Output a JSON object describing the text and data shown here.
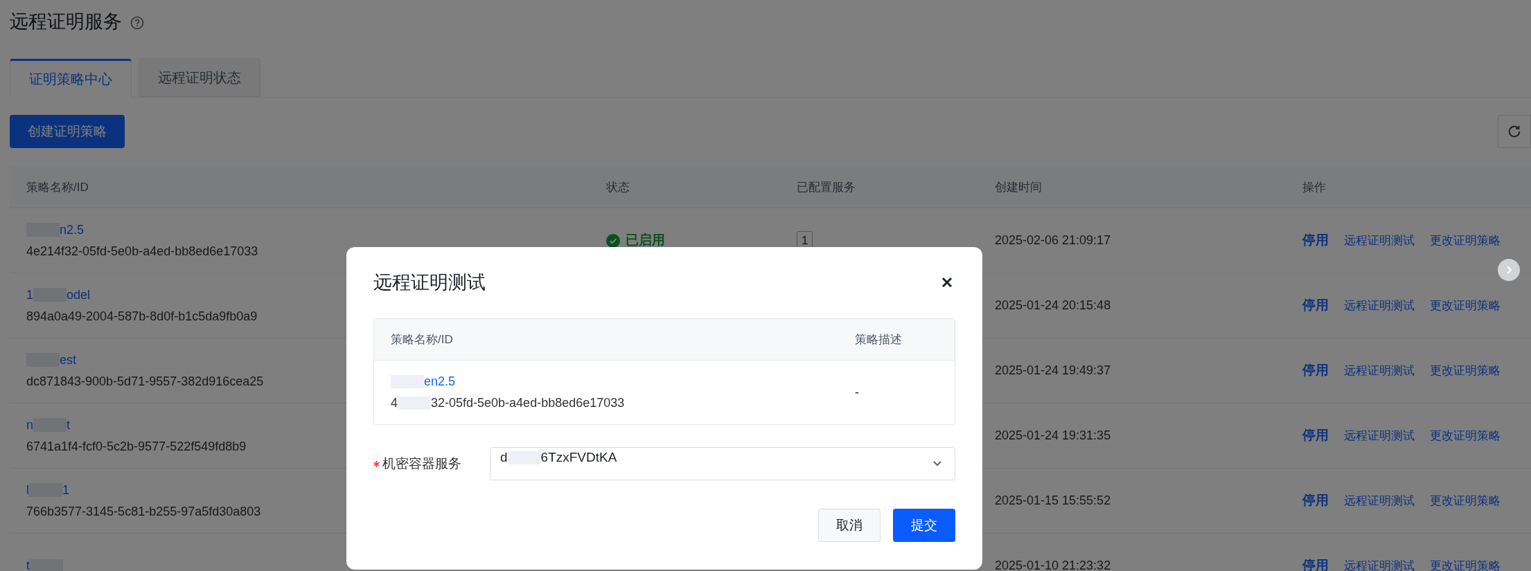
{
  "page": {
    "title": "远程证明服务"
  },
  "tabs": [
    {
      "label": "证明策略中心",
      "selected": true
    },
    {
      "label": "远程证明状态",
      "selected": false
    }
  ],
  "create_button": "创建证明策略",
  "table": {
    "columns": [
      "策略名称/ID",
      "状态",
      "已配置服务",
      "创建时间",
      "操作"
    ],
    "rows": [
      {
        "name": {
          "parts": [
            "n2.5"
          ],
          "mask_first": true,
          "mask_last": false
        },
        "id": "4e214f32-05fd-5e0b-a4ed-bb8ed6e17033",
        "status": {
          "text": "已启用",
          "enabled": true
        },
        "services": "1",
        "created": "2025-02-06 21:09:17",
        "actions": [
          "停用",
          "远程证明测试",
          "更改证明策略"
        ]
      },
      {
        "name": {
          "parts": [
            "1",
            "odel"
          ],
          "mask_first": false,
          "mask_last": false
        },
        "id": "894a0a49-2004-587b-8d0f-b1c5da9fb0a9",
        "created": "2025-01-24 20:15:48",
        "actions": [
          "停用",
          "远程证明测试",
          "更改证明策略"
        ]
      },
      {
        "name": {
          "parts": [
            "est"
          ],
          "mask_first": true,
          "mask_last": false
        },
        "id": "dc871843-900b-5d71-9557-382d916cea25",
        "created": "2025-01-24 19:49:37",
        "actions": [
          "停用",
          "远程证明测试",
          "更改证明策略"
        ]
      },
      {
        "name": {
          "parts": [
            "n",
            "t"
          ],
          "mask_first": false,
          "mask_last": false
        },
        "id": "6741a1f4-fcf0-5c2b-9577-522f549fd8b9",
        "created": "2025-01-24 19:31:35",
        "actions": [
          "停用",
          "远程证明测试",
          "更改证明策略"
        ]
      },
      {
        "name": {
          "parts": [
            "l",
            "1"
          ],
          "mask_first": false,
          "mask_last": false
        },
        "id": "766b3577-3145-5c81-b255-97a5fd30a803",
        "created": "2025-01-15 15:55:52",
        "actions": [
          "停用",
          "远程证明测试",
          "更改证明策略"
        ]
      },
      {
        "name": {
          "parts": [
            "t"
          ],
          "mask_first": false,
          "mask_last": true
        },
        "created": "2025-01-10 21:23:32",
        "actions": [
          "停用",
          "远程证明测试",
          "更改证明策略"
        ]
      }
    ]
  },
  "modal": {
    "title": "远程证明测试",
    "table": {
      "columns": [
        "策略名称/ID",
        "策略描述"
      ],
      "rows": [
        {
          "name": {
            "parts": [
              "en2.5"
            ],
            "mask_first": true,
            "mask_last": false
          },
          "id": {
            "parts": [
              "4",
              "32-05fd-5e0b-a4ed-bb8ed6e17033"
            ],
            "mask_first": false,
            "mask_last": false
          },
          "description": "-"
        }
      ]
    },
    "field": {
      "label": "机密容器服务",
      "required": true,
      "value": {
        "parts": [
          "d",
          "6TzxFVDtKA"
        ],
        "mask_first": false,
        "mask_last": false
      }
    },
    "buttons": [
      {
        "label": "取消",
        "kind": "secondary"
      },
      {
        "label": "提交",
        "kind": "primary"
      }
    ]
  }
}
